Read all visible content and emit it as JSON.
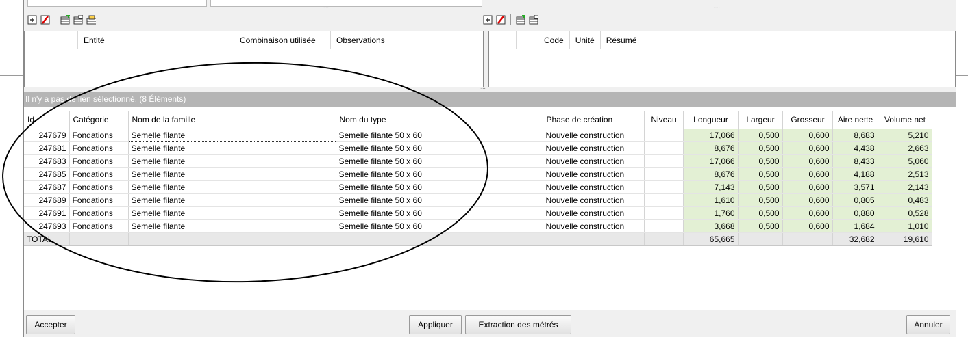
{
  "colors": {
    "panel_bg": "#f0f0f0",
    "status_bar": "#b5b5b5",
    "numeric_cell": "#e3f0d4",
    "total_row": "#e8e8e8"
  },
  "left_toolbar": {
    "icons": [
      "add-icon",
      "delete-icon",
      "export-table-icon",
      "copy-table-icon",
      "print-table-icon"
    ]
  },
  "right_toolbar": {
    "icons": [
      "add-icon",
      "delete-icon",
      "export-table-icon",
      "copy-table-icon"
    ]
  },
  "left_pane": {
    "columns": [
      "Entité",
      "Combinaison utilisée",
      "Observations"
    ]
  },
  "right_pane": {
    "columns": [
      "Code",
      "Unité",
      "Résumé"
    ]
  },
  "status": "Il n'y a pas de lien sélectionné. (8 Éléments)",
  "grid": {
    "columns": [
      "Id",
      "Catégorie",
      "Nom de la famille",
      "Nom du type",
      "Phase de création",
      "Niveau",
      "Longueur",
      "Largeur",
      "Grosseur",
      "Aire nette",
      "Volume net"
    ],
    "rows": [
      [
        "247679",
        "Fondations",
        "Semelle filante",
        "Semelle filante 50 x 60",
        "Nouvelle construction",
        "",
        "17,066",
        "0,500",
        "0,600",
        "8,683",
        "5,210"
      ],
      [
        "247681",
        "Fondations",
        "Semelle filante",
        "Semelle filante 50 x 60",
        "Nouvelle construction",
        "",
        "8,676",
        "0,500",
        "0,600",
        "4,438",
        "2,663"
      ],
      [
        "247683",
        "Fondations",
        "Semelle filante",
        "Semelle filante 50 x 60",
        "Nouvelle construction",
        "",
        "17,066",
        "0,500",
        "0,600",
        "8,433",
        "5,060"
      ],
      [
        "247685",
        "Fondations",
        "Semelle filante",
        "Semelle filante 50 x 60",
        "Nouvelle construction",
        "",
        "8,676",
        "0,500",
        "0,600",
        "4,188",
        "2,513"
      ],
      [
        "247687",
        "Fondations",
        "Semelle filante",
        "Semelle filante 50 x 60",
        "Nouvelle construction",
        "",
        "7,143",
        "0,500",
        "0,600",
        "3,571",
        "2,143"
      ],
      [
        "247689",
        "Fondations",
        "Semelle filante",
        "Semelle filante 50 x 60",
        "Nouvelle construction",
        "",
        "1,610",
        "0,500",
        "0,600",
        "0,805",
        "0,483"
      ],
      [
        "247691",
        "Fondations",
        "Semelle filante",
        "Semelle filante 50 x 60",
        "Nouvelle construction",
        "",
        "1,760",
        "0,500",
        "0,600",
        "0,880",
        "0,528"
      ],
      [
        "247693",
        "Fondations",
        "Semelle filante",
        "Semelle filante 50 x 60",
        "Nouvelle construction",
        "",
        "3,668",
        "0,500",
        "0,600",
        "1,684",
        "1,010"
      ]
    ],
    "total": [
      "TOTAL",
      "",
      "",
      "",
      "",
      "",
      "65,665",
      "",
      "",
      "32,682",
      "19,610"
    ]
  },
  "buttons": {
    "accept": "Accepter",
    "apply": "Appliquer",
    "extract": "Extraction des métrés",
    "cancel": "Annuler"
  }
}
